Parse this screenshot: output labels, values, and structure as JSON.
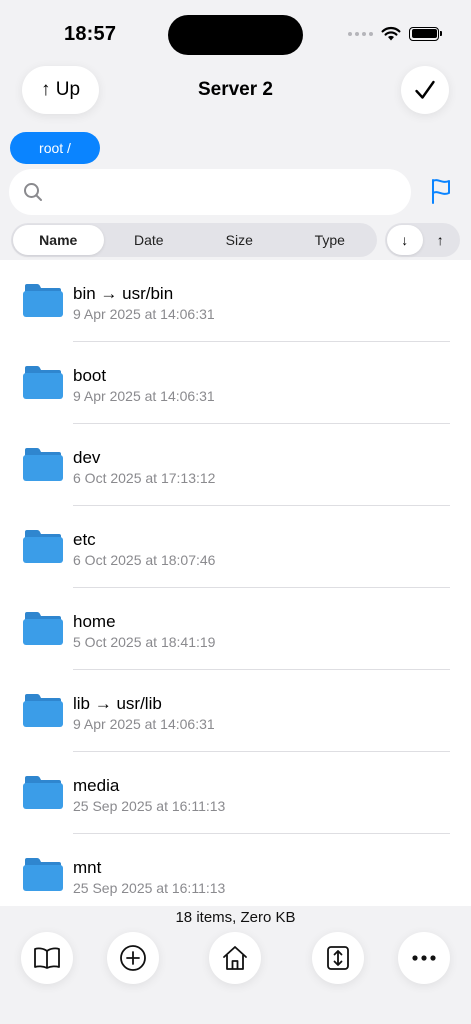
{
  "status_bar": {
    "time": "18:57"
  },
  "nav": {
    "up_label": "↑ Up",
    "title": "Server 2"
  },
  "path_chip": "root /",
  "search": {
    "value": "",
    "placeholder": ""
  },
  "sort": {
    "options": [
      "Name",
      "Date",
      "Size",
      "Type"
    ],
    "selected": "Name",
    "directions": [
      "↓",
      "↑"
    ],
    "selected_direction": "↓"
  },
  "files": [
    {
      "name": "bin → usr/bin",
      "date": "9 Apr 2025 at 14:06:31"
    },
    {
      "name": "boot",
      "date": "9 Apr 2025 at 14:06:31"
    },
    {
      "name": "dev",
      "date": "6 Oct 2025 at 17:13:12"
    },
    {
      "name": "etc",
      "date": "6 Oct 2025 at 18:07:46"
    },
    {
      "name": "home",
      "date": "5 Oct 2025 at 18:41:19"
    },
    {
      "name": "lib → usr/lib",
      "date": "9 Apr 2025 at 14:06:31"
    },
    {
      "name": "media",
      "date": "25 Sep 2025 at 16:11:13"
    },
    {
      "name": "mnt",
      "date": "25 Sep 2025 at 16:11:13"
    }
  ],
  "footer": {
    "summary": "18 items, Zero KB"
  },
  "toolbar_icons": [
    "book-icon",
    "add-circle-icon",
    "home-icon",
    "resize-vertical-icon",
    "more-icon"
  ],
  "colors": {
    "accent": "#0a84ff",
    "folder": "#3b9de8",
    "background": "#f2f2f4"
  }
}
